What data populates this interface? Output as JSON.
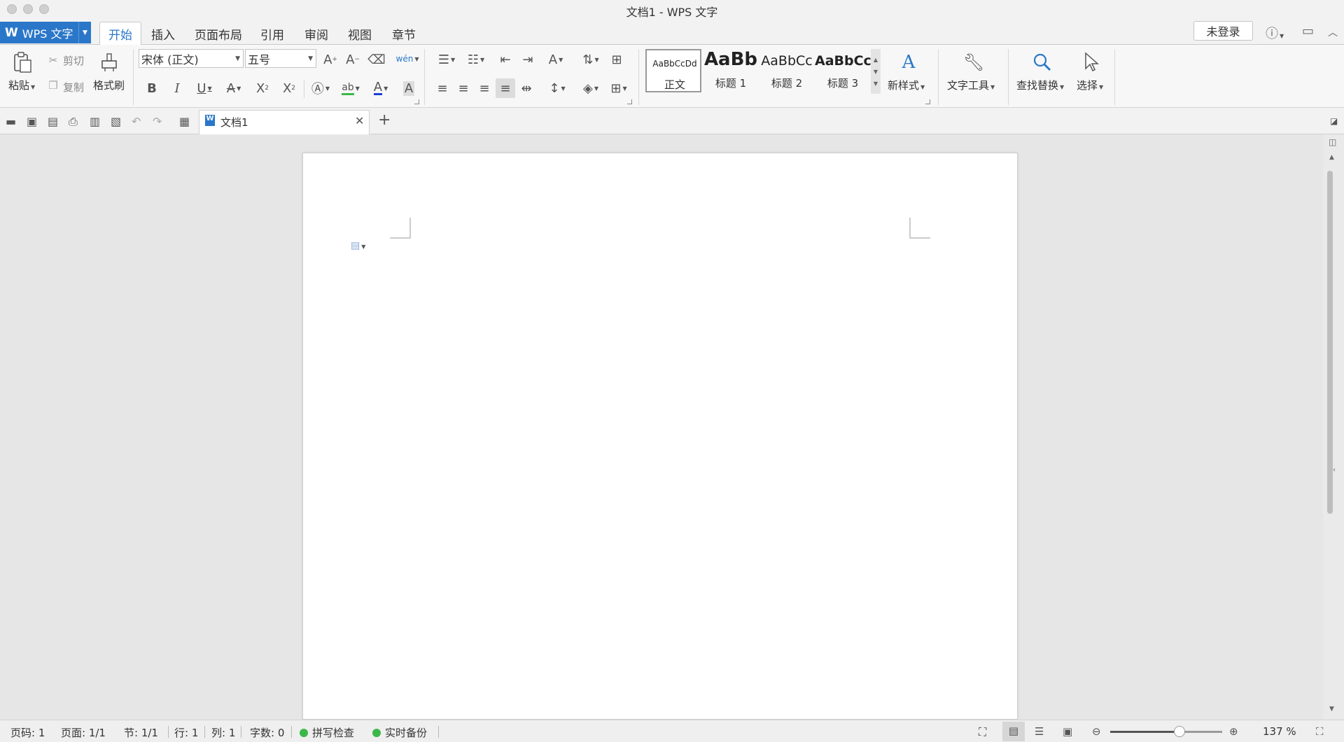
{
  "window": {
    "title": "文档1 - WPS 文字"
  },
  "app_menu": {
    "label": "WPS 文字"
  },
  "tabs": [
    {
      "label": "开始",
      "active": true
    },
    {
      "label": "插入"
    },
    {
      "label": "页面布局"
    },
    {
      "label": "引用"
    },
    {
      "label": "审阅"
    },
    {
      "label": "视图"
    },
    {
      "label": "章节"
    }
  ],
  "account": {
    "login_label": "未登录"
  },
  "ribbon": {
    "clipboard": {
      "paste": "粘贴",
      "cut": "剪切",
      "copy": "复制",
      "format_painter": "格式刷"
    },
    "font": {
      "family": "宋体 (正文)",
      "size": "五号",
      "phonetic": "wén"
    },
    "styles": [
      {
        "preview": "AaBbCcDd",
        "name": "正文"
      },
      {
        "preview": "AaBb",
        "name": "标题 1"
      },
      {
        "preview": "AaBbCc",
        "name": "标题 2"
      },
      {
        "preview": "AaBbCc",
        "name": "标题 3"
      }
    ],
    "new_style": "新样式",
    "text_tools": "文字工具",
    "find_replace": "查找替换",
    "select": "选择",
    "accent_color": "#2a77c9"
  },
  "document_tab": {
    "title": "文档1"
  },
  "status": {
    "page_code": "页码: 1",
    "pages": "页面: 1/1",
    "section": "节: 1/1",
    "row": "行: 1",
    "column": "列: 1",
    "word_count": "字数: 0",
    "spell_check": "拼写检查",
    "auto_backup": "实时备份",
    "zoom": "137 %",
    "zoom_level": 0.62,
    "indicator_color": "#3cb84a"
  }
}
